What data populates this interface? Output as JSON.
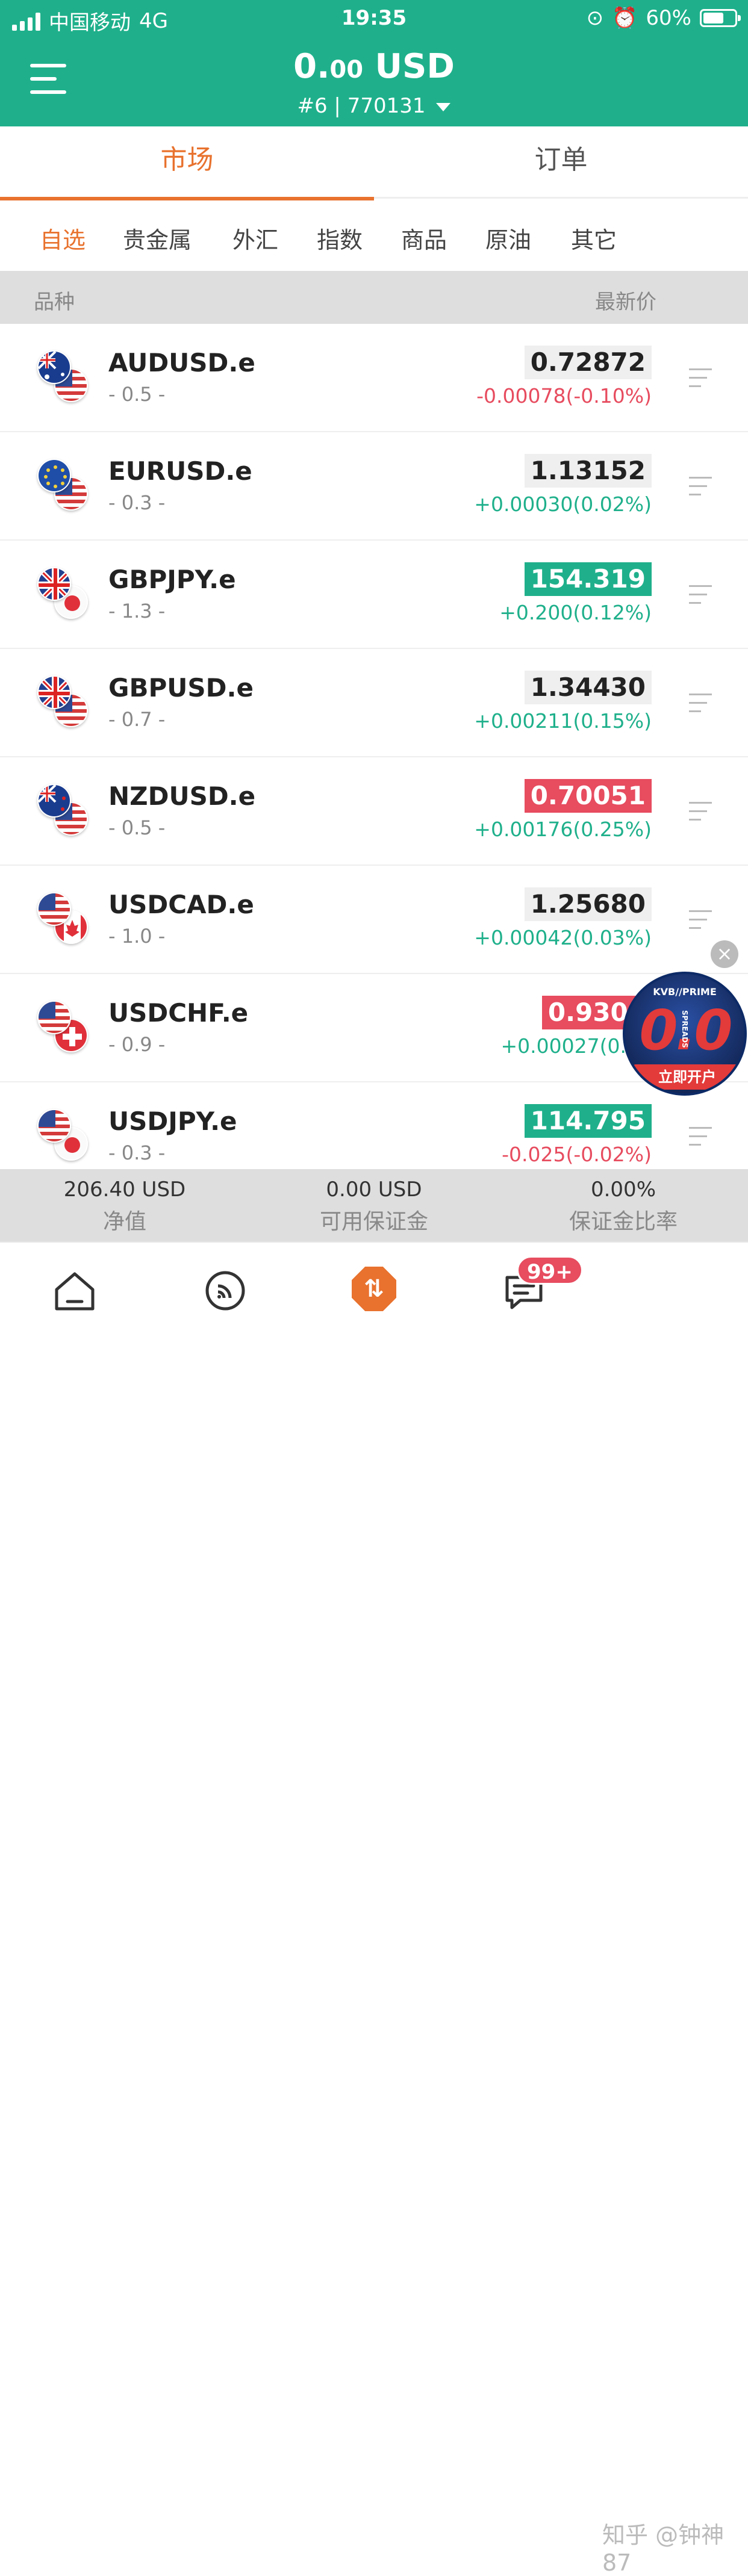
{
  "status_bar": {
    "carrier": "中国移动",
    "network": "4G",
    "time": "19:35",
    "battery": "60%"
  },
  "header": {
    "balance_main": "0.",
    "balance_small": "00",
    "balance_currency": " USD",
    "account": "#6 | 770131"
  },
  "tabs": [
    {
      "label": "市场"
    },
    {
      "label": "订单"
    }
  ],
  "categories": [
    {
      "label": "自选"
    },
    {
      "label": "贵金属"
    },
    {
      "label": "外汇"
    },
    {
      "label": "指数"
    },
    {
      "label": "商品"
    },
    {
      "label": "原油"
    },
    {
      "label": "其它"
    }
  ],
  "columns": {
    "symbol": "品种",
    "price": "最新价"
  },
  "quotes": [
    {
      "symbol": "AUDUSD.e",
      "spread": "- 0.5 -",
      "price": "0.72872",
      "change": "-0.00078(-0.10%)",
      "price_state": "neutral",
      "change_dir": "neg"
    },
    {
      "symbol": "EURUSD.e",
      "spread": "- 0.3 -",
      "price": "1.13152",
      "change": "+0.00030(0.02%)",
      "price_state": "neutral",
      "change_dir": "pos"
    },
    {
      "symbol": "GBPJPY.e",
      "spread": "- 1.3 -",
      "price": "154.319",
      "change": "+0.200(0.12%)",
      "price_state": "up",
      "change_dir": "pos"
    },
    {
      "symbol": "GBPUSD.e",
      "spread": "- 0.7 -",
      "price": "1.34430",
      "change": "+0.00211(0.15%)",
      "price_state": "neutral",
      "change_dir": "pos"
    },
    {
      "symbol": "NZDUSD.e",
      "spread": "- 0.5 -",
      "price": "0.70051",
      "change": "+0.00176(0.25%)",
      "price_state": "down",
      "change_dir": "pos"
    },
    {
      "symbol": "USDCAD.e",
      "spread": "- 1.0 -",
      "price": "1.25680",
      "change": "+0.00042(0.03%)",
      "price_state": "neutral",
      "change_dir": "pos"
    },
    {
      "symbol": "USDCHF.e",
      "spread": "- 0.9 -",
      "price": "0.9308",
      "change": "+0.00027(0.02",
      "price_state": "down",
      "change_dir": "pos"
    },
    {
      "symbol": "USDJPY.e",
      "spread": "- 0.3 -",
      "price": "114.795",
      "change": "-0.025(-0.02%)",
      "price_state": "up",
      "change_dir": "neg"
    }
  ],
  "summary": [
    {
      "value": "206.40 USD",
      "label": "净值"
    },
    {
      "value": "0.00 USD",
      "label": "可用保证金"
    },
    {
      "value": "0.00%",
      "label": "保证金比率"
    }
  ],
  "promo": {
    "brand": "KVB//PRIME",
    "big_text": "0.0",
    "sub_text": "SPREADS",
    "cta": "立即开户",
    "close": "×"
  },
  "nav": {
    "badge": "99+",
    "watermark": "知乎 @钟神87"
  },
  "colors": {
    "brand_green": "#1fb08b",
    "accent_orange": "#e8722e",
    "down_red": "#e74c5f"
  }
}
